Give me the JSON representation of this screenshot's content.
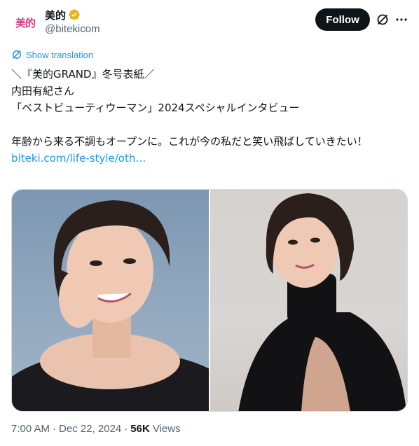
{
  "account": {
    "avatar_text": "美的",
    "display_name": "美的",
    "handle": "@bitekicom",
    "verified": true,
    "brand_color": "#e6347f",
    "verified_color": "#e2b719"
  },
  "actions": {
    "follow_label": "Follow",
    "grok_icon": "grok-icon",
    "more_icon": "more-icon"
  },
  "translation": {
    "label": "Show translation"
  },
  "tweet": {
    "lines": [
      "＼『美的GRAND』冬号表紙／",
      "内田有紀さん",
      "「ベストビューティウーマン」2024スペシャルインタビュー",
      "",
      "年齢から来る不調もオープンに。これが今の私だと笑い飛ばしていきたい！"
    ],
    "link": "biteki.com/life-style/oth…"
  },
  "media": {
    "photos": [
      "photo-1",
      "photo-2"
    ]
  },
  "meta": {
    "time": "7:00 AM",
    "date": "Dec 22, 2024",
    "views_count": "56K",
    "views_label": "Views"
  },
  "colors": {
    "link": "#1d9bf0",
    "text": "#0f1419",
    "secondary": "#536471"
  }
}
